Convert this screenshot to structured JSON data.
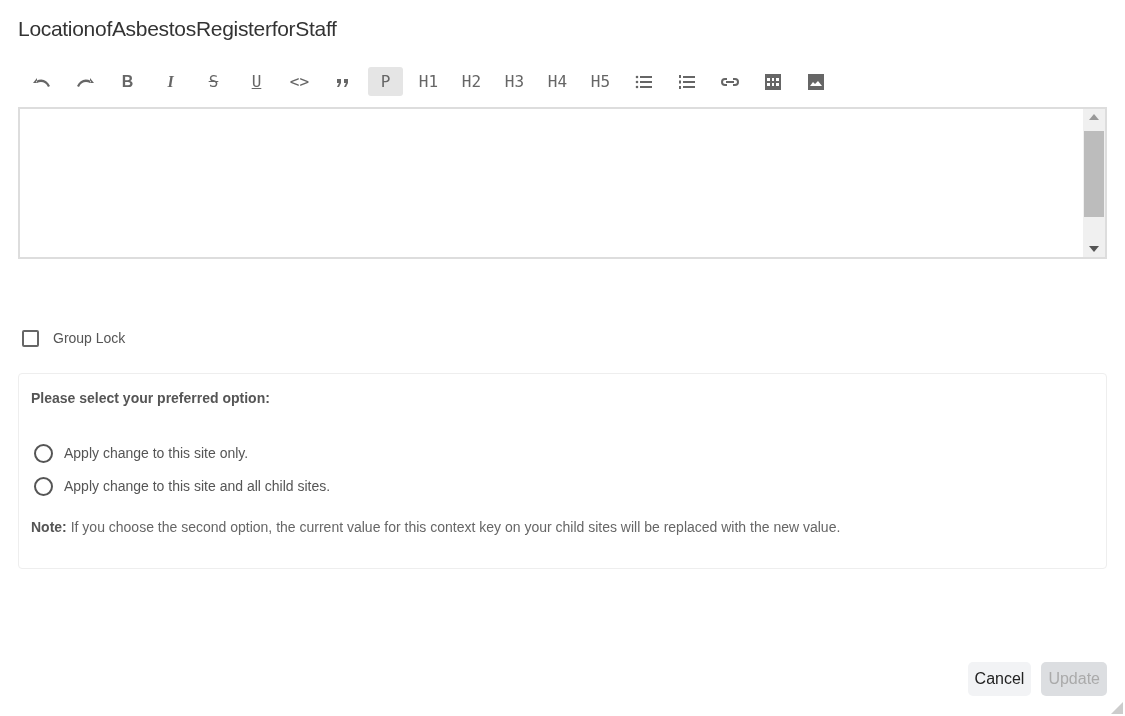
{
  "title": "LocationofAsbestosRegisterforStaff",
  "toolbar": [
    {
      "kind": "undo"
    },
    {
      "kind": "redo"
    },
    {
      "kind": "bold",
      "label": "B"
    },
    {
      "kind": "italic",
      "label": "I"
    },
    {
      "kind": "strike",
      "label": "S"
    },
    {
      "kind": "underline",
      "label": "U"
    },
    {
      "kind": "code",
      "label": "<>"
    },
    {
      "kind": "quote"
    },
    {
      "kind": "format",
      "label": "P",
      "selected": true
    },
    {
      "kind": "format",
      "label": "H1",
      "selected": false
    },
    {
      "kind": "format",
      "label": "H2",
      "selected": false
    },
    {
      "kind": "format",
      "label": "H3",
      "selected": false
    },
    {
      "kind": "format",
      "label": "H4",
      "selected": false
    },
    {
      "kind": "format",
      "label": "H5",
      "selected": false
    },
    {
      "kind": "bullets"
    },
    {
      "kind": "numbers"
    },
    {
      "kind": "link"
    },
    {
      "kind": "table"
    },
    {
      "kind": "image"
    }
  ],
  "group_lock": {
    "label": "Group Lock",
    "checked": false
  },
  "options": {
    "heading": "Please select your preferred option:",
    "choices": [
      {
        "label": "Apply change to this site only.",
        "selected": false
      },
      {
        "label": "Apply change to this site and all child sites.",
        "selected": false
      }
    ],
    "note": "**Note:** If you choose the second option, the current value for this context key on your child sites will be replaced with the new value."
  },
  "buttons": [
    {
      "label": "Cancel",
      "disabled": false
    },
    {
      "label": "Update",
      "disabled": true
    }
  ]
}
